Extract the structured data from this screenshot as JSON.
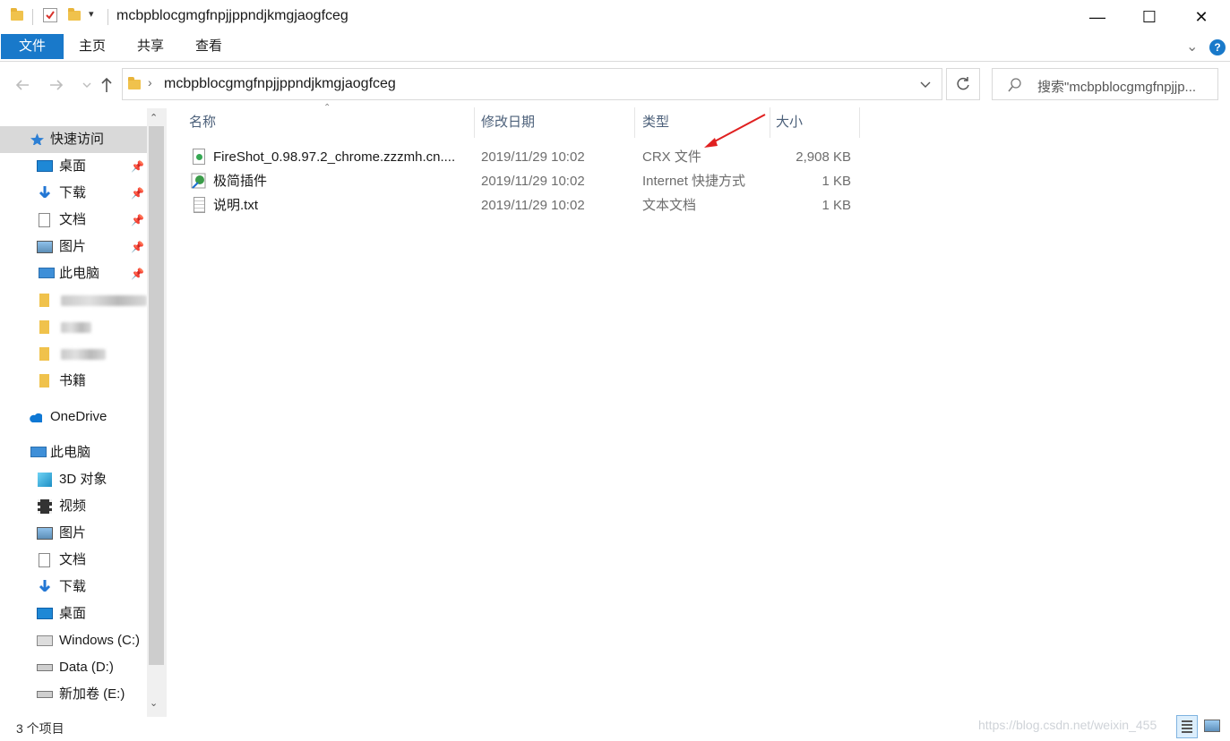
{
  "window": {
    "title": "mcbpblocgmgfnpjjppndjkmgjaogfceg",
    "minimize": "—",
    "maximize": "☐",
    "close": "✕"
  },
  "ribbon": {
    "tabs": [
      "文件",
      "主页",
      "共享",
      "查看"
    ],
    "expand_glyph": "⌄",
    "help_glyph": "?"
  },
  "address": {
    "path": "mcbpblocgmgfnpjjppndjkmgjaogfceg",
    "search_placeholder": "搜索\"mcbpblocgmgfnpjjp..."
  },
  "nav": {
    "quick_access": "快速访问",
    "quick_items": [
      "桌面",
      "下载",
      "文档",
      "图片",
      "此电脑"
    ],
    "folder_books": "书籍",
    "onedrive": "OneDrive",
    "this_pc": "此电脑",
    "pc_items": [
      "3D 对象",
      "视频",
      "图片",
      "文档",
      "下载",
      "桌面",
      "Windows (C:)",
      "Data (D:)",
      "新加卷 (E:)"
    ]
  },
  "columns": {
    "name": "名称",
    "modified": "修改日期",
    "type": "类型",
    "size": "大小"
  },
  "files": [
    {
      "name": "FireShot_0.98.97.2_chrome.zzzmh.cn....",
      "modified": "2019/11/29 10:02",
      "type": "CRX 文件",
      "size": "2,908 KB",
      "icon": "crx-file-icon"
    },
    {
      "name": "极简插件",
      "modified": "2019/11/29 10:02",
      "type": "Internet 快捷方式",
      "size": "1 KB",
      "icon": "internet-shortcut-icon"
    },
    {
      "name": "说明.txt",
      "modified": "2019/11/29 10:02",
      "type": "文本文档",
      "size": "1 KB",
      "icon": "text-file-icon"
    }
  ],
  "status": {
    "item_count": "3 个项目",
    "watermark": "https://blog.csdn.net/weixin_455"
  },
  "colors": {
    "accent": "#1979ca",
    "selected_nav": "#d9d9d9",
    "annotation_arrow": "#e02020"
  }
}
